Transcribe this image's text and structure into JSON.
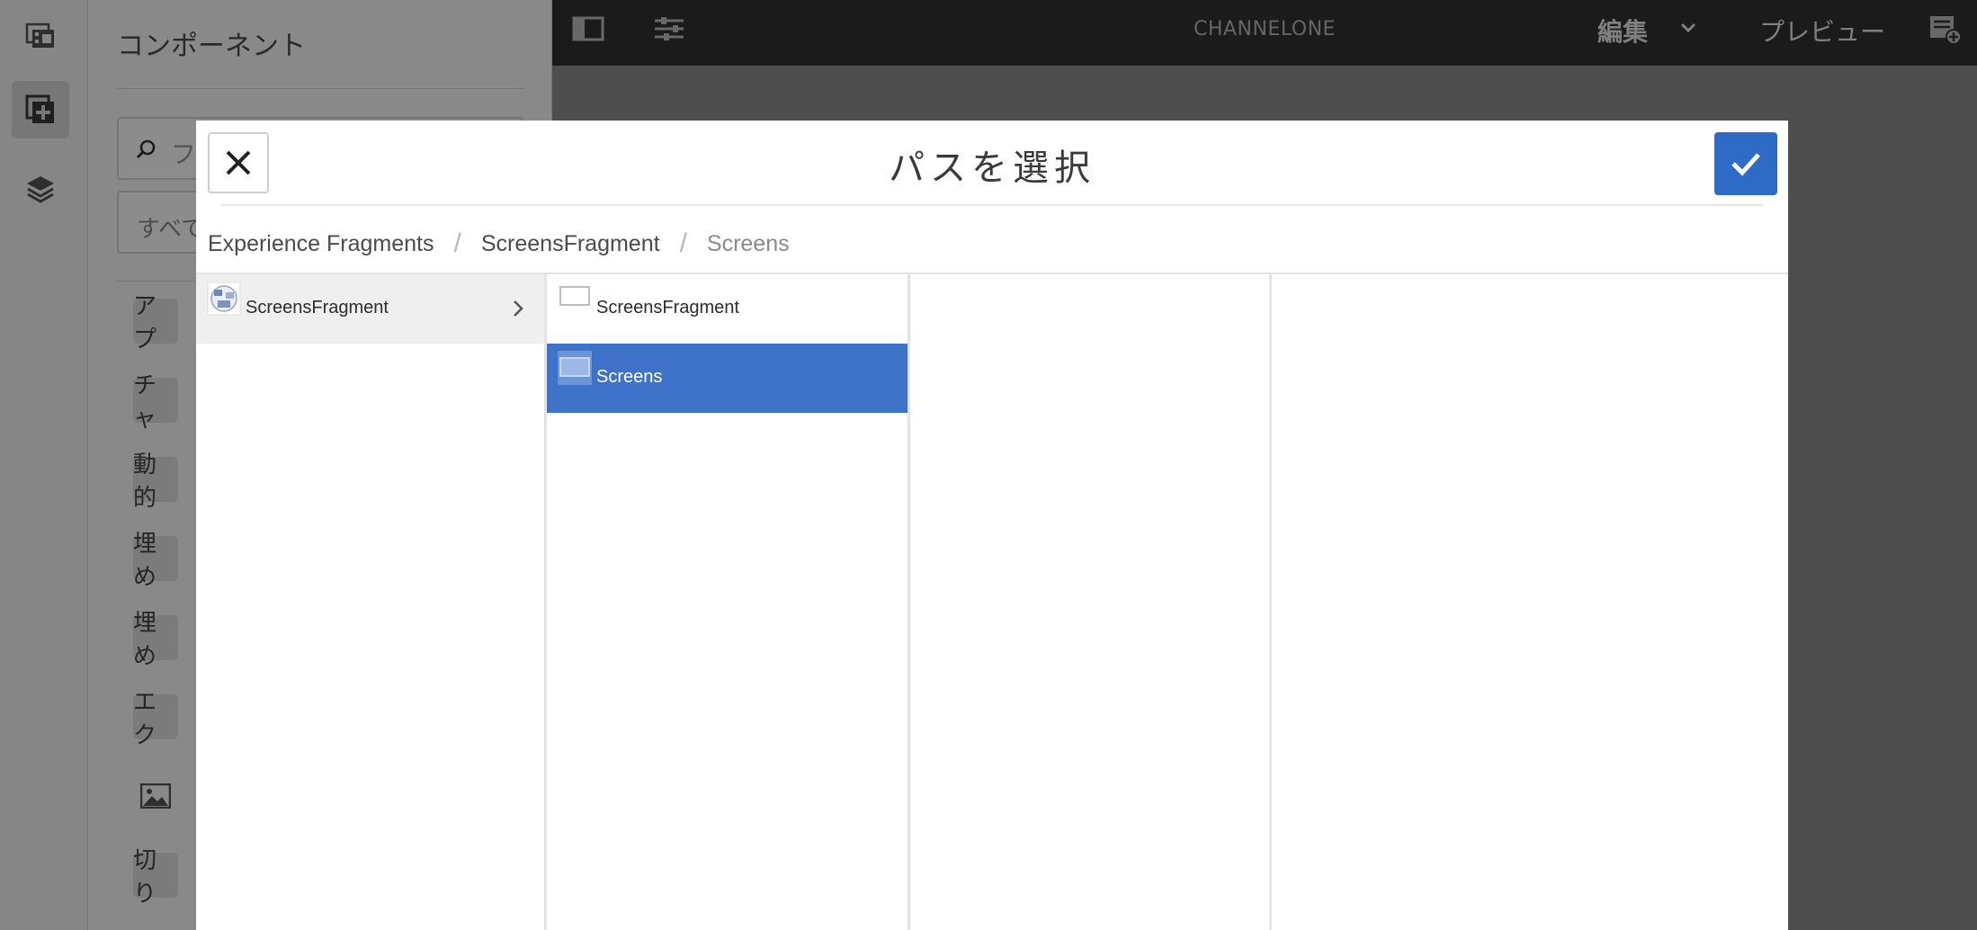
{
  "editor": {
    "page_title": "CHANNELONE",
    "mode_label": "編集",
    "preview_label": "プレビュー"
  },
  "side_panel": {
    "title": "コンポーネント",
    "search_placeholder": "フィ",
    "group_select_value": "すべて",
    "components": [
      "アプ",
      "チャ",
      "動的",
      "埋め",
      "埋め",
      "エク",
      "",
      "切り"
    ]
  },
  "dialog": {
    "title": "パスを選択",
    "breadcrumbs": [
      "Experience Fragments",
      "ScreensFragment",
      "Screens"
    ],
    "columns": [
      {
        "items": [
          {
            "label": "ScreensFragment",
            "type": "folder",
            "has_children": true
          }
        ]
      },
      {
        "items": [
          {
            "label": "ScreensFragment",
            "type": "page",
            "selected": false
          },
          {
            "label": "Screens",
            "type": "page",
            "selected": true
          }
        ]
      },
      {
        "items": []
      },
      {
        "items": []
      }
    ]
  },
  "colors": {
    "accent": "#2e6bc7",
    "selection": "#3f73c9",
    "topbar": "#323232"
  },
  "icons": {
    "rail": [
      "film-strip-icon",
      "add-component-icon",
      "layers-icon"
    ],
    "topbar": [
      "side-panel-toggle-icon",
      "page-properties-icon",
      "chevron-down-icon",
      "annotation-icon"
    ],
    "dialog": [
      "close-icon",
      "checkmark-icon",
      "chevron-right-icon",
      "folder-thumbnail-icon",
      "page-thumbnail-icon"
    ]
  }
}
